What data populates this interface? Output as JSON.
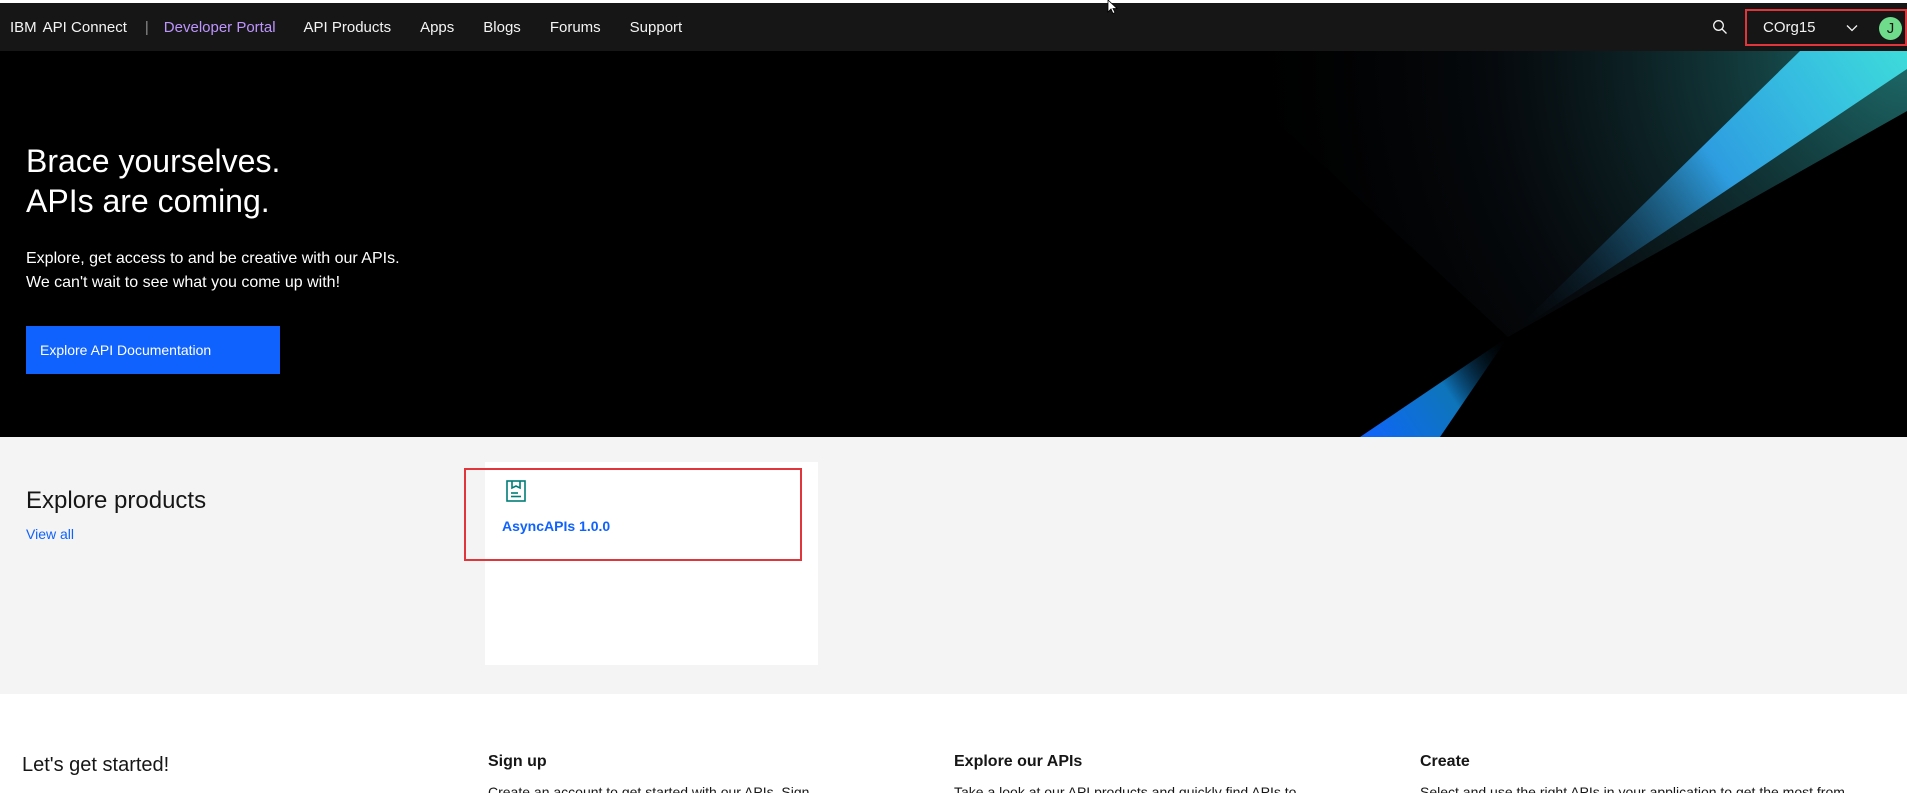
{
  "header": {
    "brand_ibm": "IBM",
    "brand_product": "API Connect",
    "brand_separator": "|",
    "brand_portal": "Developer Portal",
    "nav": [
      "API Products",
      "Apps",
      "Blogs",
      "Forums",
      "Support"
    ],
    "org_name": "COrg15",
    "avatar_initial": "J",
    "accent_portal_color": "#be95ff"
  },
  "hero": {
    "title_line1": "Brace yourselves.",
    "title_line2": "APIs are coming.",
    "subtitle_line1": "Explore, get access to and be creative with our APIs.",
    "subtitle_line2": "We can't wait to see what you come up with!",
    "cta_label": "Explore API Documentation"
  },
  "products": {
    "title": "Explore products",
    "view_all": "View all",
    "cards": [
      {
        "title": "AsyncAPIs 1.0.0",
        "icon": "product-box-icon"
      }
    ]
  },
  "get_started": {
    "title": "Let's get started!",
    "columns": [
      {
        "heading": "Sign up",
        "text": "Create an account to get started with our APIs. Sign"
      },
      {
        "heading": "Explore our APIs",
        "text": "Take a look at our API products and quickly find APIs to"
      },
      {
        "heading": "Create",
        "text": "Select and use the right APIs in your application to get the most from"
      }
    ]
  },
  "colors": {
    "header_bg": "#161616",
    "hero_bg": "#000000",
    "primary_blue": "#0f62fe",
    "highlight_red": "#e0353a",
    "products_bg": "#f4f4f4"
  }
}
